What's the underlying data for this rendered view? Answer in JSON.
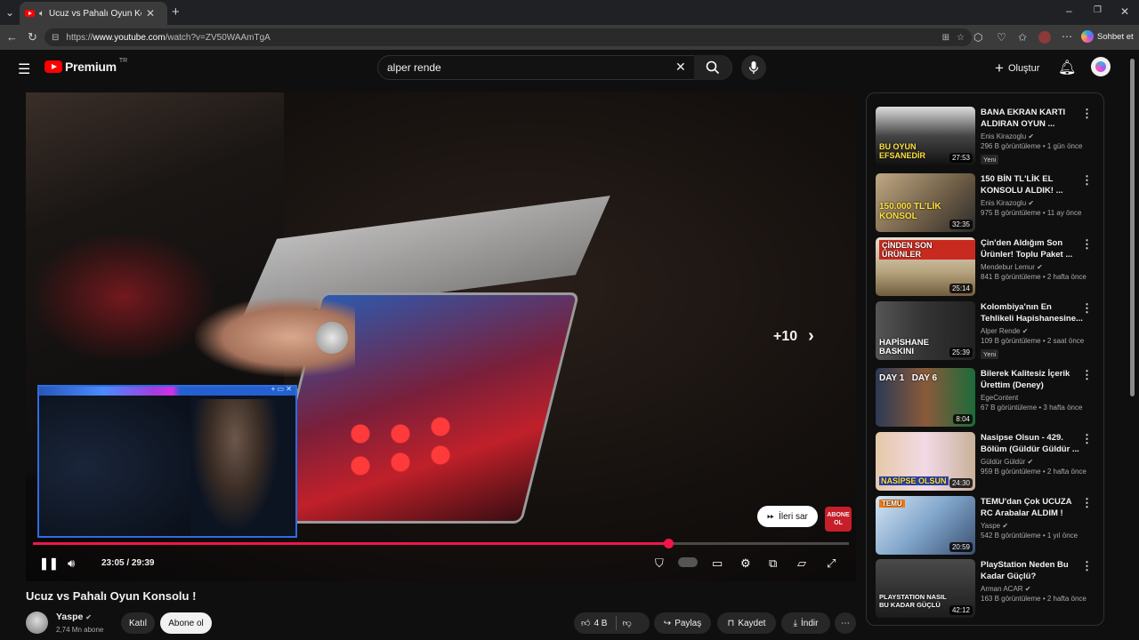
{
  "browser": {
    "tab_title": "Ucuz vs Pahalı Oyun Konsolu",
    "url_prefix": "https://",
    "url_host": "www.youtube.com",
    "url_path": "/watch?v=ZV50WAAmTgA",
    "copilot_label": "Sohbet et"
  },
  "header": {
    "logo_text": "Premium",
    "logo_region": "TR",
    "search_value": "alper rende",
    "create_label": "Oluştur"
  },
  "player": {
    "time_current": "23:05",
    "time_sep": " / ",
    "time_total": "29:39",
    "progress_fraction": 0.7785,
    "seek_overlay": "+10",
    "skip_label": "İleri sar",
    "subscribe_watermark": "ABONE OL"
  },
  "video": {
    "title": "Ucuz vs Pahalı Oyun Konsolu !",
    "channel": "Yaspe",
    "subscribers": "2,74 Mn abone",
    "join_label": "Katıl",
    "subscribe_label": "Abone ol",
    "likes": "4 B",
    "share_label": "Paylaş",
    "save_label": "Kaydet",
    "download_label": "İndir"
  },
  "recommendations": [
    {
      "title": "BANA EKRAN KARTI ALDIRAN OYUN ...",
      "channel": "Enis Kirazoglu",
      "meta": "296 B görüntüleme • 1 gün önce",
      "badge": "Yeni",
      "duration": "27:53",
      "thumb_text": "BU OYUN EFSANEDİR"
    },
    {
      "title": "150 BİN TL'LİK EL KONSOLU ALDIK! ...",
      "channel": "Enis Kirazoglu",
      "meta": "975 B görüntüleme • 11 ay önce",
      "badge": "",
      "duration": "32:35",
      "thumb_text": "150.000 TL'LİK KONSOL"
    },
    {
      "title": "Çin'den Aldığım Son Ürünler! Toplu Paket ...",
      "channel": "Mendebur Lemur",
      "meta": "841 B görüntüleme • 2 hafta önce",
      "badge": "",
      "duration": "25:14",
      "thumb_text": "ÇİNDEN SON ÜRÜNLER"
    },
    {
      "title": "Kolombiya'nın En Tehlikeli Hapishanesine...",
      "channel": "Alper Rende",
      "meta": "109 B görüntüleme • 2 saat önce",
      "badge": "Yeni",
      "duration": "25:39",
      "thumb_text": "HAPİSHANE BASKINI"
    },
    {
      "title": "Bilerek Kalitesiz İçerik Ürettim (Deney)",
      "channel": "EgeContent",
      "meta": "67 B görüntüleme • 3 hafta önce",
      "badge": "",
      "duration": "8:04",
      "thumb_text": "DAY 1   DAY 6"
    },
    {
      "title": "Nasipse Olsun - 429. Bölüm (Güldür Güldür ...",
      "channel": "Güldür Güldür",
      "meta": "959 B görüntüleme • 2 hafta önce",
      "badge": "",
      "duration": "24:30",
      "thumb_text": "NASİPSE OLSUN"
    },
    {
      "title": "TEMU'dan Çok UCUZA RC Arabalar ALDIM !",
      "channel": "Yaspe",
      "meta": "542 B görüntüleme • 1 yıl önce",
      "badge": "",
      "duration": "20:59",
      "thumb_text": "TEMU"
    },
    {
      "title": "PlayStation Neden Bu Kadar Güçlü?",
      "channel": "Arman ACAR",
      "meta": "163 B görüntüleme • 2 hafta önce",
      "badge": "",
      "duration": "42:12",
      "thumb_text": "PLAYSTATION NASIL BU KADAR GÜÇLÜ"
    }
  ],
  "colors": {
    "accent_red": "#ff0000",
    "progress_red": "#f0164b",
    "background": "#0f0f0f"
  }
}
